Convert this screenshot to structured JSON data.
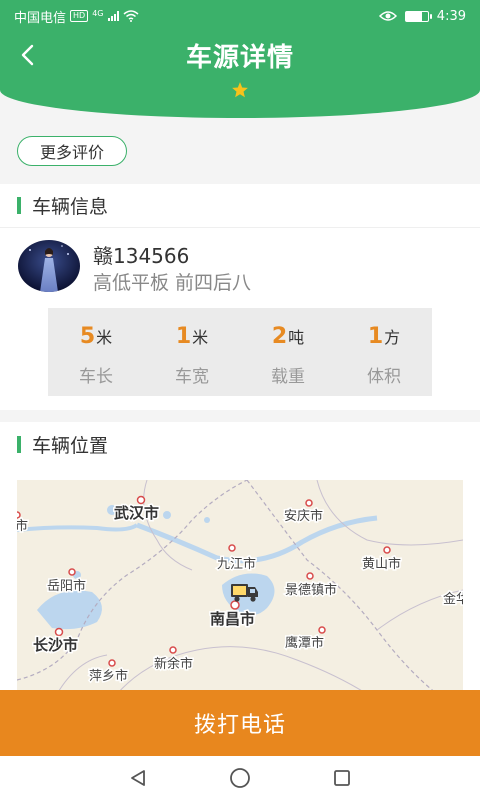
{
  "status_bar": {
    "carrier": "中国电信",
    "hd": "HD",
    "network": "4G",
    "time": "4:39",
    "battery_level": 0.75
  },
  "header": {
    "title": "车源详情",
    "back_icon": "chevron-left-icon",
    "favorite_icon": "star-icon"
  },
  "reviews": {
    "more_label": "更多评价"
  },
  "vehicle_info": {
    "section_title": "车辆信息",
    "plate": "赣134566",
    "type": "高低平板 前四后八",
    "specs": [
      {
        "value": "5",
        "unit": "米",
        "label": "车长"
      },
      {
        "value": "1",
        "unit": "米",
        "label": "车宽"
      },
      {
        "value": "2",
        "unit": "吨",
        "label": "载重"
      },
      {
        "value": "1",
        "unit": "方",
        "label": "体积"
      }
    ]
  },
  "vehicle_location": {
    "section_title": "车辆位置",
    "map_labels": {
      "wuhan": "武汉市",
      "anqing": "安庆市",
      "jiujiang": "九江市",
      "huangshan": "黄山市",
      "yueyang": "岳阳市",
      "jingdezhen": "景德镇市",
      "nanchang": "南昌市",
      "changsha": "长沙市",
      "yingtan": "鹰潭市",
      "xinyu": "新余市",
      "pingxiang": "萍乡市",
      "partial_left": "市",
      "partial_right": "金华"
    }
  },
  "actions": {
    "call_label": "拨打电话"
  },
  "nav_bar": {
    "back_icon": "triangle-back-icon",
    "home_icon": "circle-home-icon",
    "recents_icon": "square-recents-icon"
  },
  "colors": {
    "brand_green": "#3bb16a",
    "accent_orange": "#e8871e",
    "spec_number": "#e78a22"
  }
}
